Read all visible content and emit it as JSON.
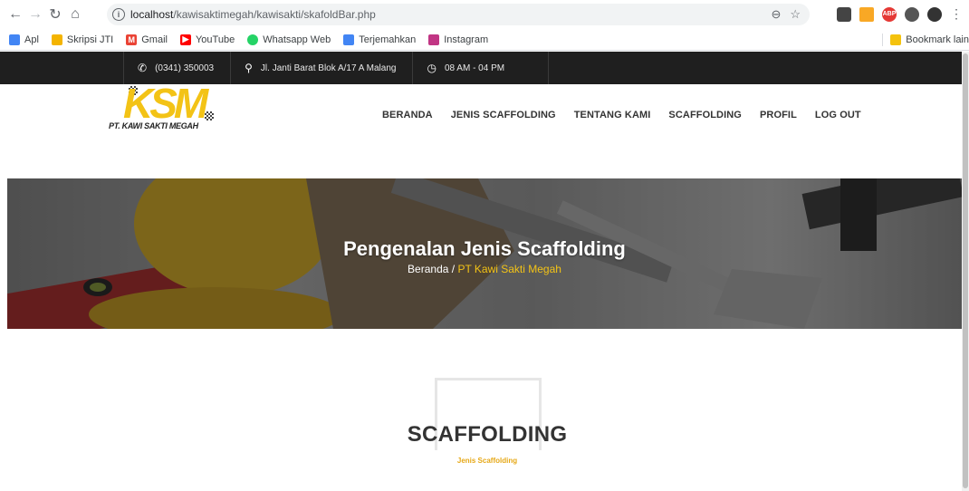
{
  "browser": {
    "url_host": "localhost",
    "url_path": "/kawisaktimegah/kawisakti/skafoldBar.php",
    "bookmarks": [
      "Apl",
      "Skripsi JTI",
      "Gmail",
      "YouTube",
      "Whatsapp Web",
      "Terjemahkan",
      "Instagram"
    ],
    "bookmark_other": "Bookmark lain"
  },
  "topbar": {
    "phone": "(0341) 350003",
    "address": "Jl. Janti Barat Blok A/17 A Malang",
    "hours": "08 AM - 04 PM"
  },
  "logo": {
    "mark": "KSM",
    "name": "PT. KAWI SAKTI MEGAH"
  },
  "menu": [
    "BERANDA",
    "JENIS SCAFFOLDING",
    "TENTANG KAMI",
    "SCAFFOLDING",
    "PROFIL",
    "LOG OUT"
  ],
  "hero": {
    "title": "Pengenalan Jenis Scaffolding",
    "crumb_home": "Beranda",
    "crumb_sep": " / ",
    "crumb_current": "PT Kawi Sakti Megah"
  },
  "section": {
    "title": "SCAFFOLDING",
    "subtitle": "Jenis Scaffolding"
  },
  "colors": {
    "accent": "#f3c316",
    "topbar": "#1f1f1f"
  }
}
